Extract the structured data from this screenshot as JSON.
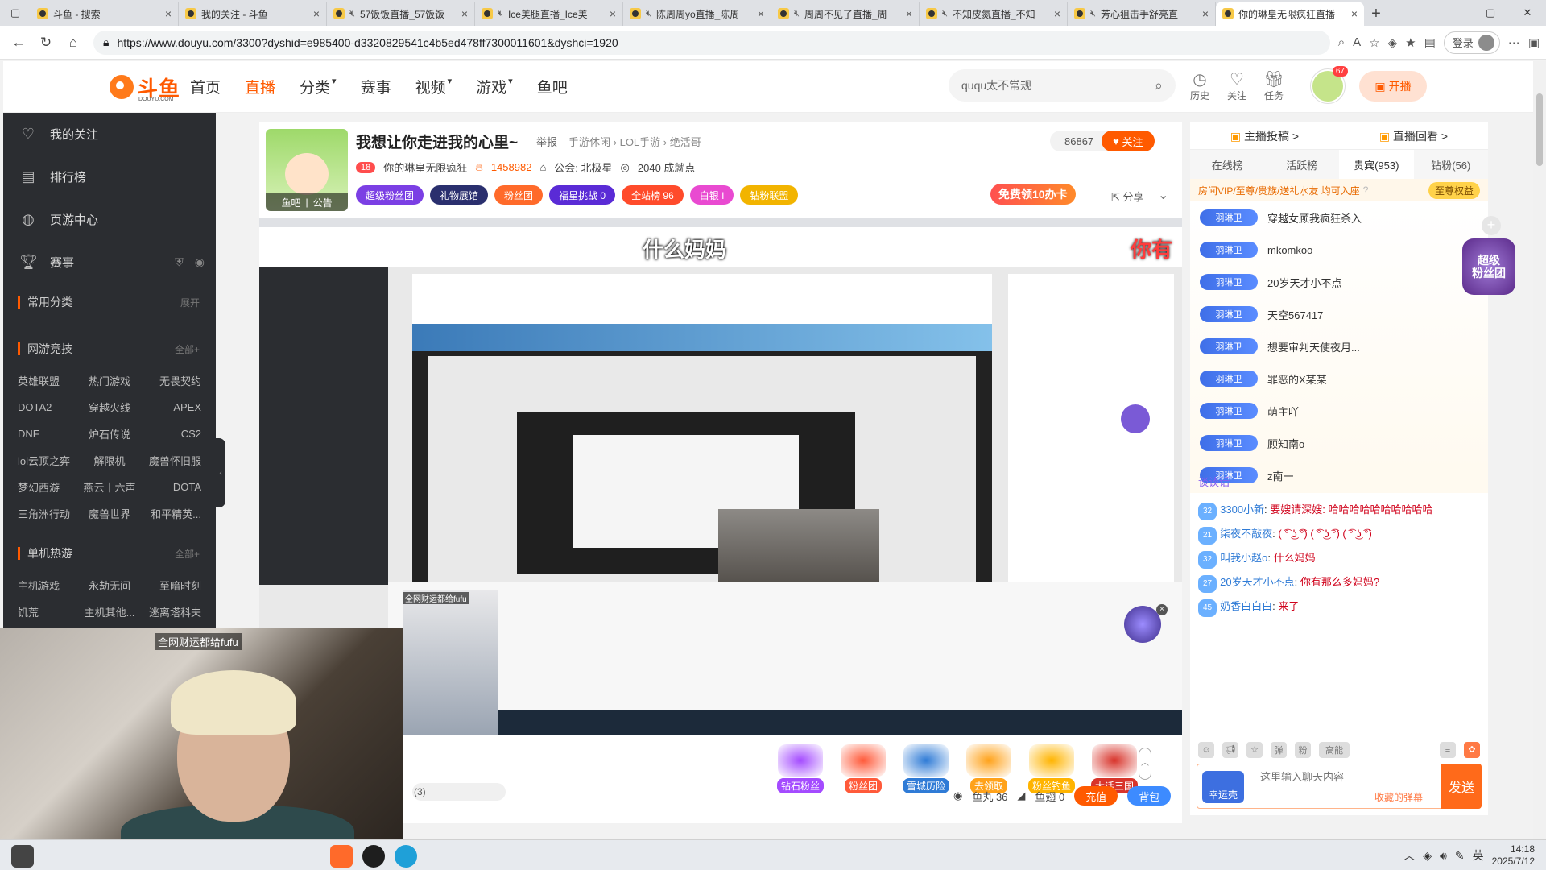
{
  "browser": {
    "tabs": [
      {
        "title": "斗鱼 - 搜索",
        "muted": false,
        "active": false
      },
      {
        "title": "我的关注 - 斗鱼",
        "muted": false,
        "active": false
      },
      {
        "title": "57饭饭直播_57饭饭",
        "muted": true,
        "active": false
      },
      {
        "title": "Ice美腿直播_Ice美",
        "muted": true,
        "active": false
      },
      {
        "title": "陈周周yo直播_陈周",
        "muted": true,
        "active": false
      },
      {
        "title": "周周不见了直播_周",
        "muted": true,
        "active": false
      },
      {
        "title": "不知皮氮直播_不知",
        "muted": true,
        "active": false
      },
      {
        "title": "芳心狙击手舒亮直",
        "muted": true,
        "active": false
      },
      {
        "title": "你的琳皇无限疯狂直播",
        "muted": false,
        "active": true
      }
    ],
    "url": "https://www.douyu.com/3300?dyshid=e985400-d3320829541c4b5ed478ff7300011601&dyshci=1920",
    "login_label": "登录"
  },
  "site": {
    "logo_text": "斗鱼",
    "logo_sub": "DOUYU.COM",
    "nav": [
      {
        "label": "首页",
        "active": false,
        "caret": false
      },
      {
        "label": "直播",
        "active": true,
        "caret": false
      },
      {
        "label": "分类",
        "active": false,
        "caret": true
      },
      {
        "label": "赛事",
        "active": false,
        "caret": false
      },
      {
        "label": "视频",
        "active": false,
        "caret": true
      },
      {
        "label": "游戏",
        "active": false,
        "caret": true
      },
      {
        "label": "鱼吧",
        "active": false,
        "caret": false
      }
    ],
    "search_value": "ququ太不常规",
    "header_icons": [
      {
        "label": "历史",
        "icon": "clock-icon"
      },
      {
        "label": "关注",
        "icon": "heart-icon"
      },
      {
        "label": "任务",
        "icon": "gift-icon"
      }
    ],
    "avatar_badge": "67",
    "start_live_label": "开播"
  },
  "sidebar": {
    "items": [
      {
        "label": "我的关注",
        "icon": "heart-icon"
      },
      {
        "label": "排行榜",
        "icon": "ranking-icon"
      },
      {
        "label": "页游中心",
        "icon": "controller-icon"
      },
      {
        "label": "赛事",
        "icon": "trophy-icon"
      }
    ],
    "common_title": "常用分类",
    "common_more": "展开",
    "esports_title": "网游竞技",
    "esports_more": "全部+",
    "esports": [
      "英雄联盟",
      "热门游戏",
      "无畏契约",
      "DOTA2",
      "穿越火线",
      "APEX",
      "DNF",
      "炉石传说",
      "CS2",
      "lol云顶之弈",
      "解限机",
      "魔兽怀旧服",
      "梦幻西游",
      "燕云十六声",
      "DOTA",
      "三角洲行动",
      "魔兽世界",
      "和平精英..."
    ],
    "single_title": "单机热游",
    "single_more": "全部+",
    "single": [
      "主机游戏",
      "永劫无间",
      "至暗时刻",
      "饥荒",
      "主机其他...",
      "逃离塔科夫"
    ]
  },
  "room": {
    "title": "我想让你走进我的心里~",
    "report": "举报",
    "categories": [
      "手游休闲",
      "LOL手游",
      "绝活哥"
    ],
    "avatar_tags": [
      "鱼吧",
      "公告"
    ],
    "level_badge": "18",
    "anchor_name": "你的琳皇无限疯狂",
    "heat": "1458982",
    "guild": "公会: 北极星",
    "achievements": "2040 成就点",
    "badges": [
      {
        "label": "超级粉丝团",
        "color": "#7b3fe4"
      },
      {
        "label": "礼物展馆",
        "color": "#2a2f6e"
      },
      {
        "label": "粉丝团",
        "color": "#ff6a2a"
      },
      {
        "label": "福星挑战  0",
        "color": "#5a2bd6"
      },
      {
        "label": "全站榜  96",
        "color": "#ff4b2b"
      },
      {
        "label": "白银 I",
        "color": "#e94ad1"
      },
      {
        "label": "钻粉联盟",
        "color": "#f2b400"
      }
    ],
    "follow_count": "86867",
    "follow_label": "关注",
    "free_card": "免费领10办卡",
    "share": "分享"
  },
  "video": {
    "subtitle": "什么妈妈",
    "subtitle_right": "你有",
    "webcam_label": "全网财运都给fufu",
    "webcam_label_small": "全网财运都给fufu",
    "viewers": "(3)",
    "fish_balls": "鱼丸 36",
    "fish_fins": "鱼翅 0",
    "recharge": "充值",
    "backpack": "背包"
  },
  "gifts": [
    {
      "label": "钻石粉丝",
      "color": "#a44bff"
    },
    {
      "label": "粉丝团",
      "color": "#ff5a3a"
    },
    {
      "label": "雪城历险",
      "color": "#2f7bd6"
    },
    {
      "label": "去领取",
      "color": "#ffa21a"
    },
    {
      "label": "粉丝钓鱼",
      "color": "#ffb400"
    },
    {
      "label": "大话三国",
      "color": "#d8342b"
    }
  ],
  "chat": {
    "top": [
      "主播投稿 >",
      "直播回看 >"
    ],
    "tabs": [
      {
        "label": "在线榜",
        "active": false
      },
      {
        "label": "活跃榜",
        "active": false
      },
      {
        "label": "贵宾(953)",
        "active": true
      },
      {
        "label": "钻粉(56)",
        "active": false
      }
    ],
    "vip_text": "房间VIP/至尊/贵族/送礼水友 均可入座",
    "vip_button": "至尊权益",
    "ranks": [
      {
        "badge": "羽琳卫",
        "name": "穿越女顾我疯狂杀入"
      },
      {
        "badge": "羽琳卫",
        "name": "mkomkoo"
      },
      {
        "badge": "羽琳卫",
        "name": "20岁天才小不点"
      },
      {
        "badge": "羽琳卫",
        "name": "天空567417"
      },
      {
        "badge": "羽琳卫",
        "name": "想要审判天使夜月..."
      },
      {
        "badge": "羽琳卫",
        "name": "罪恶的X某某"
      },
      {
        "badge": "羽琳卫",
        "name": "萌主吖"
      },
      {
        "badge": "羽琳卫",
        "name": "顾知南o"
      },
      {
        "badge": "羽琳卫",
        "name": "z南一"
      }
    ],
    "superfan": "超级\n粉丝团",
    "hint": "谈谈话",
    "messages": [
      {
        "level": "32",
        "user": "3300小新",
        "text": "要嫂请深嫂: 哈哈哈哈哈哈哈哈哈哈"
      },
      {
        "level": "21",
        "user": "柒夜不敲夜",
        "text": "( ͡° ͜ʖ ͡°) ( ͡° ͜ʖ ͡°) ( ͡° ͜ʖ ͡°)"
      },
      {
        "level": "32",
        "user": "叫我小赵o",
        "text": "什么妈妈"
      },
      {
        "level": "27",
        "user": "20岁天才小不点",
        "text": "你有那么多妈妈?"
      },
      {
        "level": "45",
        "user": "奶香白白白",
        "text": "来了"
      }
    ],
    "toolbar": [
      "弹",
      "粉",
      "高能"
    ],
    "input_placeholder": "这里输入聊天内容",
    "collect": "收藏的弹幕",
    "lucky": "幸运壳",
    "send": "发送"
  },
  "taskbar": {
    "time": "14:18",
    "date": "2025/7/12",
    "ime": "英"
  }
}
